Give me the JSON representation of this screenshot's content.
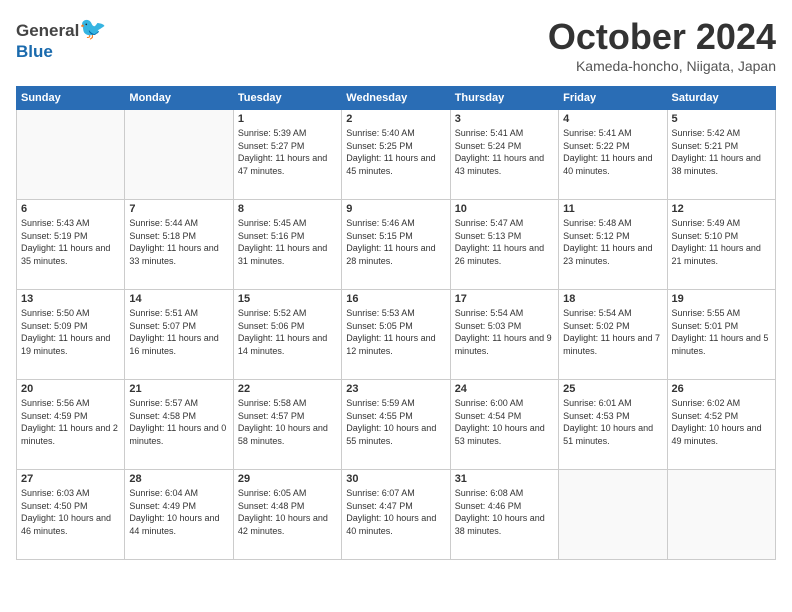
{
  "logo": {
    "general": "General",
    "blue": "Blue"
  },
  "header": {
    "month": "October 2024",
    "location": "Kameda-honcho, Niigata, Japan"
  },
  "weekdays": [
    "Sunday",
    "Monday",
    "Tuesday",
    "Wednesday",
    "Thursday",
    "Friday",
    "Saturday"
  ],
  "weeks": [
    [
      {
        "day": "",
        "sunrise": "",
        "sunset": "",
        "daylight": ""
      },
      {
        "day": "",
        "sunrise": "",
        "sunset": "",
        "daylight": ""
      },
      {
        "day": "1",
        "sunrise": "Sunrise: 5:39 AM",
        "sunset": "Sunset: 5:27 PM",
        "daylight": "Daylight: 11 hours and 47 minutes."
      },
      {
        "day": "2",
        "sunrise": "Sunrise: 5:40 AM",
        "sunset": "Sunset: 5:25 PM",
        "daylight": "Daylight: 11 hours and 45 minutes."
      },
      {
        "day": "3",
        "sunrise": "Sunrise: 5:41 AM",
        "sunset": "Sunset: 5:24 PM",
        "daylight": "Daylight: 11 hours and 43 minutes."
      },
      {
        "day": "4",
        "sunrise": "Sunrise: 5:41 AM",
        "sunset": "Sunset: 5:22 PM",
        "daylight": "Daylight: 11 hours and 40 minutes."
      },
      {
        "day": "5",
        "sunrise": "Sunrise: 5:42 AM",
        "sunset": "Sunset: 5:21 PM",
        "daylight": "Daylight: 11 hours and 38 minutes."
      }
    ],
    [
      {
        "day": "6",
        "sunrise": "Sunrise: 5:43 AM",
        "sunset": "Sunset: 5:19 PM",
        "daylight": "Daylight: 11 hours and 35 minutes."
      },
      {
        "day": "7",
        "sunrise": "Sunrise: 5:44 AM",
        "sunset": "Sunset: 5:18 PM",
        "daylight": "Daylight: 11 hours and 33 minutes."
      },
      {
        "day": "8",
        "sunrise": "Sunrise: 5:45 AM",
        "sunset": "Sunset: 5:16 PM",
        "daylight": "Daylight: 11 hours and 31 minutes."
      },
      {
        "day": "9",
        "sunrise": "Sunrise: 5:46 AM",
        "sunset": "Sunset: 5:15 PM",
        "daylight": "Daylight: 11 hours and 28 minutes."
      },
      {
        "day": "10",
        "sunrise": "Sunrise: 5:47 AM",
        "sunset": "Sunset: 5:13 PM",
        "daylight": "Daylight: 11 hours and 26 minutes."
      },
      {
        "day": "11",
        "sunrise": "Sunrise: 5:48 AM",
        "sunset": "Sunset: 5:12 PM",
        "daylight": "Daylight: 11 hours and 23 minutes."
      },
      {
        "day": "12",
        "sunrise": "Sunrise: 5:49 AM",
        "sunset": "Sunset: 5:10 PM",
        "daylight": "Daylight: 11 hours and 21 minutes."
      }
    ],
    [
      {
        "day": "13",
        "sunrise": "Sunrise: 5:50 AM",
        "sunset": "Sunset: 5:09 PM",
        "daylight": "Daylight: 11 hours and 19 minutes."
      },
      {
        "day": "14",
        "sunrise": "Sunrise: 5:51 AM",
        "sunset": "Sunset: 5:07 PM",
        "daylight": "Daylight: 11 hours and 16 minutes."
      },
      {
        "day": "15",
        "sunrise": "Sunrise: 5:52 AM",
        "sunset": "Sunset: 5:06 PM",
        "daylight": "Daylight: 11 hours and 14 minutes."
      },
      {
        "day": "16",
        "sunrise": "Sunrise: 5:53 AM",
        "sunset": "Sunset: 5:05 PM",
        "daylight": "Daylight: 11 hours and 12 minutes."
      },
      {
        "day": "17",
        "sunrise": "Sunrise: 5:54 AM",
        "sunset": "Sunset: 5:03 PM",
        "daylight": "Daylight: 11 hours and 9 minutes."
      },
      {
        "day": "18",
        "sunrise": "Sunrise: 5:54 AM",
        "sunset": "Sunset: 5:02 PM",
        "daylight": "Daylight: 11 hours and 7 minutes."
      },
      {
        "day": "19",
        "sunrise": "Sunrise: 5:55 AM",
        "sunset": "Sunset: 5:01 PM",
        "daylight": "Daylight: 11 hours and 5 minutes."
      }
    ],
    [
      {
        "day": "20",
        "sunrise": "Sunrise: 5:56 AM",
        "sunset": "Sunset: 4:59 PM",
        "daylight": "Daylight: 11 hours and 2 minutes."
      },
      {
        "day": "21",
        "sunrise": "Sunrise: 5:57 AM",
        "sunset": "Sunset: 4:58 PM",
        "daylight": "Daylight: 11 hours and 0 minutes."
      },
      {
        "day": "22",
        "sunrise": "Sunrise: 5:58 AM",
        "sunset": "Sunset: 4:57 PM",
        "daylight": "Daylight: 10 hours and 58 minutes."
      },
      {
        "day": "23",
        "sunrise": "Sunrise: 5:59 AM",
        "sunset": "Sunset: 4:55 PM",
        "daylight": "Daylight: 10 hours and 55 minutes."
      },
      {
        "day": "24",
        "sunrise": "Sunrise: 6:00 AM",
        "sunset": "Sunset: 4:54 PM",
        "daylight": "Daylight: 10 hours and 53 minutes."
      },
      {
        "day": "25",
        "sunrise": "Sunrise: 6:01 AM",
        "sunset": "Sunset: 4:53 PM",
        "daylight": "Daylight: 10 hours and 51 minutes."
      },
      {
        "day": "26",
        "sunrise": "Sunrise: 6:02 AM",
        "sunset": "Sunset: 4:52 PM",
        "daylight": "Daylight: 10 hours and 49 minutes."
      }
    ],
    [
      {
        "day": "27",
        "sunrise": "Sunrise: 6:03 AM",
        "sunset": "Sunset: 4:50 PM",
        "daylight": "Daylight: 10 hours and 46 minutes."
      },
      {
        "day": "28",
        "sunrise": "Sunrise: 6:04 AM",
        "sunset": "Sunset: 4:49 PM",
        "daylight": "Daylight: 10 hours and 44 minutes."
      },
      {
        "day": "29",
        "sunrise": "Sunrise: 6:05 AM",
        "sunset": "Sunset: 4:48 PM",
        "daylight": "Daylight: 10 hours and 42 minutes."
      },
      {
        "day": "30",
        "sunrise": "Sunrise: 6:07 AM",
        "sunset": "Sunset: 4:47 PM",
        "daylight": "Daylight: 10 hours and 40 minutes."
      },
      {
        "day": "31",
        "sunrise": "Sunrise: 6:08 AM",
        "sunset": "Sunset: 4:46 PM",
        "daylight": "Daylight: 10 hours and 38 minutes."
      },
      {
        "day": "",
        "sunrise": "",
        "sunset": "",
        "daylight": ""
      },
      {
        "day": "",
        "sunrise": "",
        "sunset": "",
        "daylight": ""
      }
    ]
  ]
}
